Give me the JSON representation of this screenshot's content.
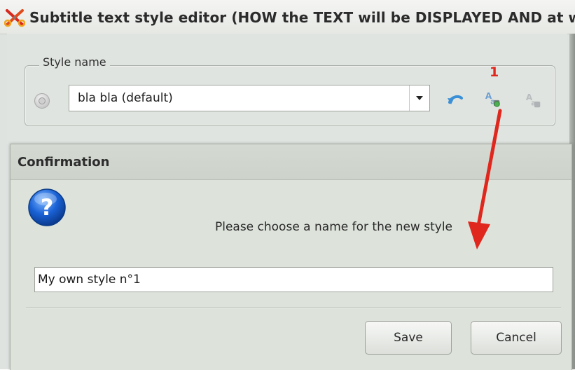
{
  "window": {
    "title": "Subtitle text style editor  (HOW the TEXT will be DISPLAYED AND at w",
    "app_icon": "scissors-x-icon"
  },
  "style_group": {
    "legend": "Style name",
    "selected_style": "bla bla (default)",
    "radio_icon": "radio-disabled-icon",
    "toolbar_icons": [
      "undo-arrow-icon",
      "add-style-icon",
      "delete-style-icon"
    ]
  },
  "annotation": {
    "number": "1",
    "arrow_color": "#e0271d"
  },
  "dialog": {
    "title": "Confirmation",
    "icon": "question-icon",
    "message": "Please choose a name for the new style",
    "input_value": "My own style n°1",
    "save_label": "Save",
    "cancel_label": "Cancel"
  },
  "colors": {
    "window_bg": "#dfe4e0",
    "dialog_bg": "#dde3db",
    "question_blue": "#1a62d6"
  }
}
